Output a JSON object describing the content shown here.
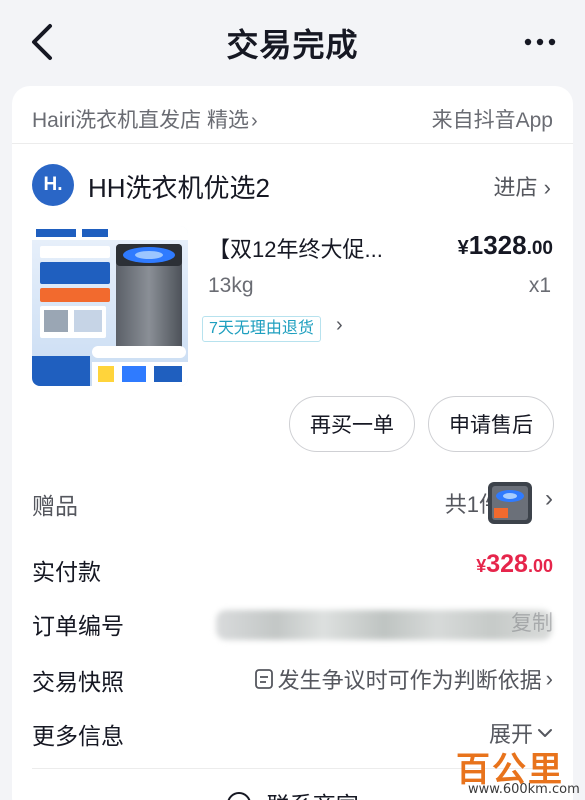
{
  "header": {
    "title": "交易完成",
    "back_icon": "chevron-left-icon",
    "more_icon": "ellipsis-icon"
  },
  "source": {
    "store_label": "Hairi洗衣机直发店 精选",
    "app_label": "来自抖音App"
  },
  "shop": {
    "avatar_text": "H.",
    "name": "HH洗衣机优选2",
    "enter_label": "进店",
    "avatar_color": "#2a66c6"
  },
  "product": {
    "title": "【双12年终大促...",
    "price_symbol": "¥",
    "price_int": "1328",
    "price_dec": ".00",
    "spec": "13kg",
    "quantity": "x1",
    "return_badge": "7天无理由退货"
  },
  "actions": {
    "rebuy_label": "再买一单",
    "aftersale_label": "申请售后"
  },
  "info": {
    "gift_label": "赠品",
    "gift_value": "共1件",
    "paid_label": "实付款",
    "paid_symbol": "¥",
    "paid_int": "328",
    "paid_dec": ".00",
    "paid_color": "#e6254b",
    "order_no_label": "订单编号",
    "order_copy_label": "复制",
    "snapshot_label": "交易快照",
    "snapshot_value": "发生争议时可作为判断依据",
    "more_info_label": "更多信息",
    "more_info_value": "展开"
  },
  "contact": {
    "label": "联系商家"
  },
  "watermark": {
    "main": "百公里",
    "url": "www.600km.com"
  }
}
